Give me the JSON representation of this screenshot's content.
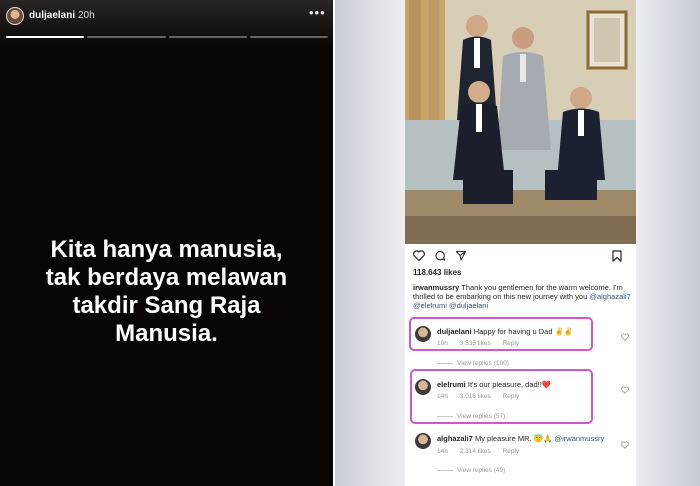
{
  "story": {
    "username": "duljaelani",
    "time": "20h",
    "more_icon": "•••",
    "quote_lines": [
      "Kita hanya manusia,",
      "tak berdaya melawan",
      "takdir Sang Raja",
      "Manusia."
    ]
  },
  "post": {
    "likes": "118.643 likes",
    "caption": {
      "username": "irwanmussry",
      "text": "Thank you gentlemen for the warm welcome. I'm thrilled to be embarking on this new journey with you",
      "mentions": "@alghazali7 @elelrumi @duljaelani"
    },
    "comments": [
      {
        "username": "duljaelani",
        "text": "Happy for having u Dad ✌️✌️",
        "time": "10h",
        "likes": "3.535 likes",
        "reply": "Reply",
        "view_replies": "View replies (100)"
      },
      {
        "username": "elelrumi",
        "text": "It's our pleasure, dad!!❤️",
        "time": "14h",
        "likes": "3.016 likes",
        "reply": "Reply",
        "view_replies": "View replies (57)"
      },
      {
        "username": "alghazali7",
        "text": "My pleasure MR. 😇🙏",
        "mention": "@irwanmussry",
        "time": "14h",
        "likes": "2.314 likes",
        "reply": "Reply",
        "view_replies": "View replies (49)"
      }
    ],
    "highlight_color": "#cf57cf"
  }
}
